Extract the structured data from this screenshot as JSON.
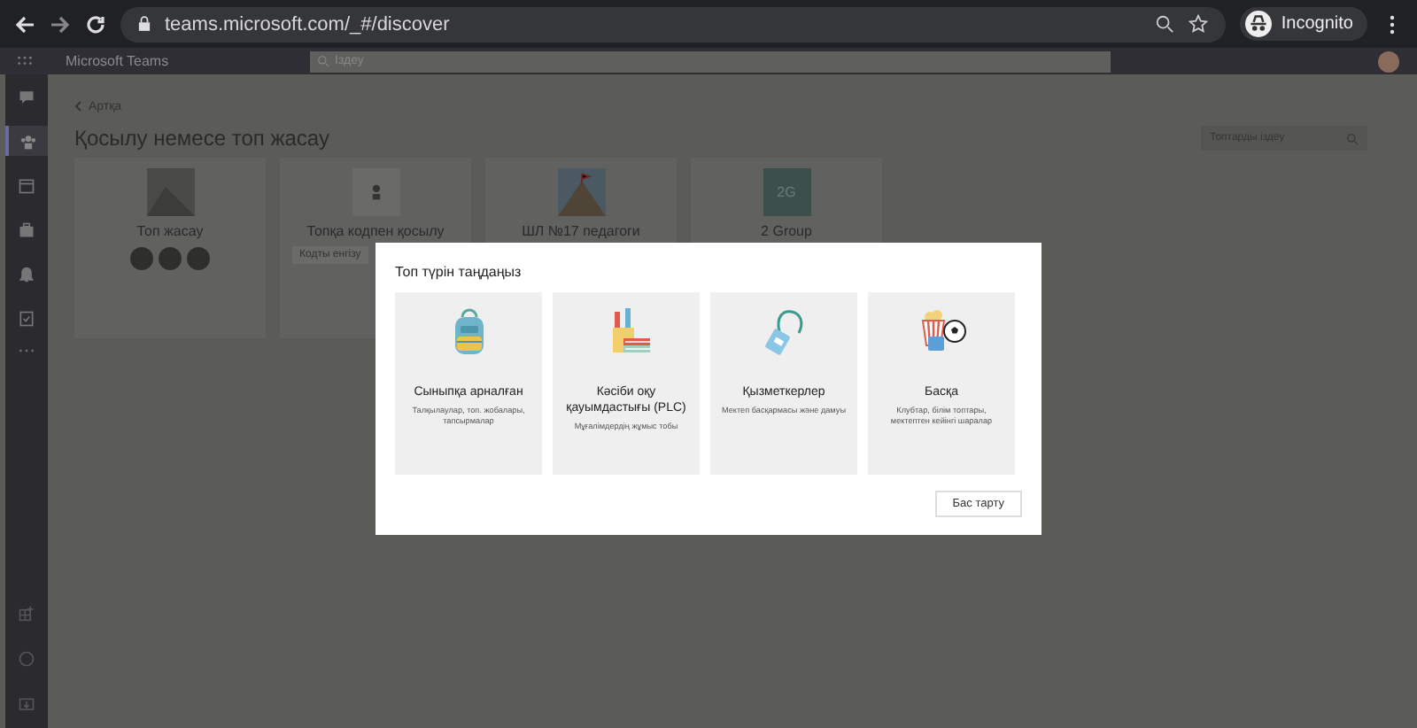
{
  "browser": {
    "url": "teams.microsoft.com/_#/discover",
    "profile": "Incognito"
  },
  "app": {
    "title": "Microsoft Teams",
    "search": {
      "placeholder": "Іздеу"
    }
  },
  "rail": [
    {
      "selected": false
    },
    {
      "selected": true
    },
    {
      "selected": false
    },
    {
      "selected": false
    },
    {
      "selected": false
    },
    {
      "selected": false
    }
  ],
  "page": {
    "back": "Артқа",
    "title": "Қосылу немесе топ жасау",
    "search": {
      "placeholder": "Топтарды іздеу"
    },
    "cards": [
      {
        "kind": "create",
        "title": "Топ жасау"
      },
      {
        "kind": "code",
        "title": "Топқа кодпен қосылу",
        "placeholder": "Кодты енгізу"
      },
      {
        "kind": "picture",
        "title": "ШЛ №17 педагоги"
      },
      {
        "kind": "initials",
        "title": "2 Group",
        "initials": "2G"
      }
    ]
  },
  "dialog": {
    "title": "Топ түрін таңдаңыз",
    "options": [
      {
        "kind": "class",
        "title": "Сыныпқа арналған",
        "description": "Талқылаулар, топ. жобалары, тапсырмалар"
      },
      {
        "kind": "plc",
        "title": "Кәсіби оқу қауымдастығы (PLC)",
        "description": "Мұғалімдердің жұмыс тобы"
      },
      {
        "kind": "staff",
        "title": "Қызметкерлер",
        "description": "Мектеп басқармасы және дамуы"
      },
      {
        "kind": "other",
        "title": "Басқа",
        "description": "Клубтар, білім топтары, мектептен кейінгі шаралар"
      }
    ],
    "cancel": "Бас тарту"
  }
}
